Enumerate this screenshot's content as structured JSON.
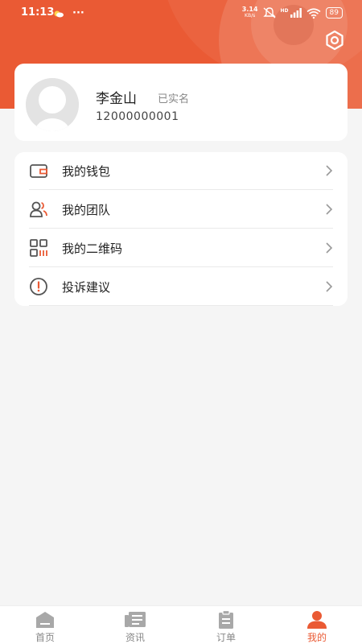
{
  "status_bar": {
    "time": "11:13",
    "dots": "···",
    "net_speed_value": "3.14",
    "net_speed_unit": "KB/s",
    "hd_label": "HD",
    "battery": "89"
  },
  "profile": {
    "name": "李金山",
    "verified_label": "已实名",
    "phone": "12000000001"
  },
  "menu": {
    "items": [
      {
        "label": "我的钱包",
        "icon": "wallet-icon"
      },
      {
        "label": "我的团队",
        "icon": "team-icon"
      },
      {
        "label": "我的二维码",
        "icon": "qrcode-icon"
      },
      {
        "label": "投诉建议",
        "icon": "complaint-icon"
      }
    ]
  },
  "tabbar": {
    "tabs": [
      {
        "label": "首页",
        "icon": "home-icon"
      },
      {
        "label": "资讯",
        "icon": "news-icon"
      },
      {
        "label": "订单",
        "icon": "orders-icon"
      },
      {
        "label": "我的",
        "icon": "profile-icon",
        "active": true
      }
    ]
  },
  "colors": {
    "accent": "#ea5a34",
    "inactive": "#a8a8a8",
    "background": "#f5f5f5"
  }
}
